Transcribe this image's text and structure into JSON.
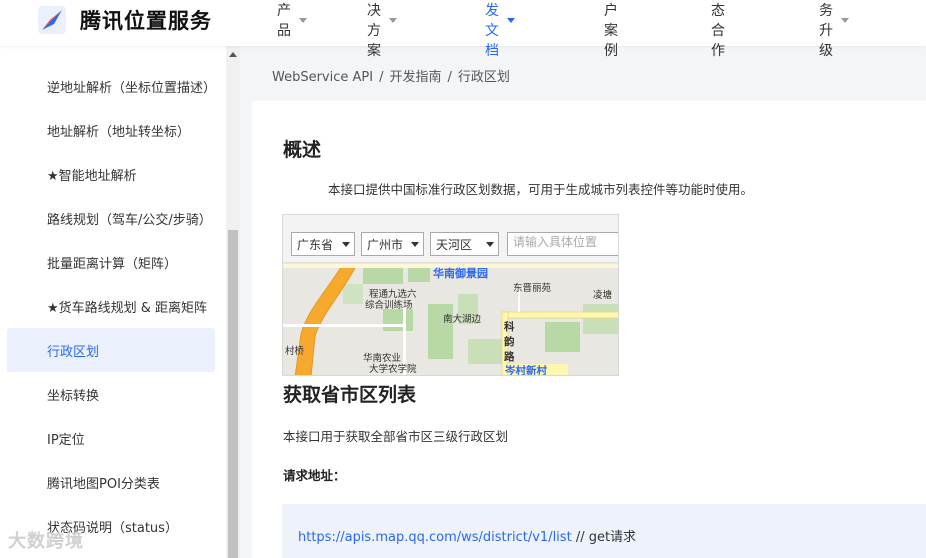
{
  "header": {
    "logo_text": "腾讯位置服务",
    "nav": [
      {
        "label": "产品",
        "dropdown": true
      },
      {
        "label": "解决方案",
        "dropdown": true
      },
      {
        "label": "开发文档",
        "dropdown": true,
        "active": true
      },
      {
        "label": "客户案例",
        "dropdown": false
      },
      {
        "label": "生态合作",
        "dropdown": false
      },
      {
        "label": "服务升级",
        "dropdown": true
      }
    ]
  },
  "sidebar": {
    "items": [
      {
        "label": "逆地址解析（坐标位置描述）"
      },
      {
        "label": "地址解析（地址转坐标）"
      },
      {
        "label": "★智能地址解析"
      },
      {
        "label": "路线规划（驾车/公交/步骑）"
      },
      {
        "label": "批量距离计算（矩阵）"
      },
      {
        "label": "★货车路线规划 & 距离矩阵"
      },
      {
        "label": "行政区划",
        "active": true
      },
      {
        "label": "坐标转换"
      },
      {
        "label": "IP定位"
      },
      {
        "label": "腾讯地图POI分类表"
      },
      {
        "label": "状态码说明（status）"
      }
    ]
  },
  "breadcrumb": [
    "WebService API",
    "/",
    "开发指南",
    "/",
    "行政区划"
  ],
  "content": {
    "overview_title": "概述",
    "overview_text": "本接口提供中国标准行政区划数据，可用于生成城市列表控件等功能时使用。",
    "map_demo": {
      "province": "广东省",
      "city": "广州市",
      "district": "天河区",
      "search_placeholder": "请输入具体位置",
      "labels": [
        "华南御景园",
        "程通九选六",
        "综合训练场",
        "东晋丽苑",
        "南大湖边",
        "凌塘",
        "科",
        "韵",
        "路",
        "岑村新村",
        "村桥",
        "华南农业",
        "大学农学院"
      ]
    },
    "section_title": "获取省市区列表",
    "section_text": "本接口用于获取全部省市区三级行政区划",
    "request_label": "请求地址：",
    "request_url": "https://apis.map.qq.com/ws/district/v1/list",
    "request_comment": "// get请求"
  },
  "watermark": "大数跨境",
  "colors": {
    "accent": "#2a68f0",
    "active_bg": "#eaf1fd",
    "code_bg": "#eef3fb"
  }
}
